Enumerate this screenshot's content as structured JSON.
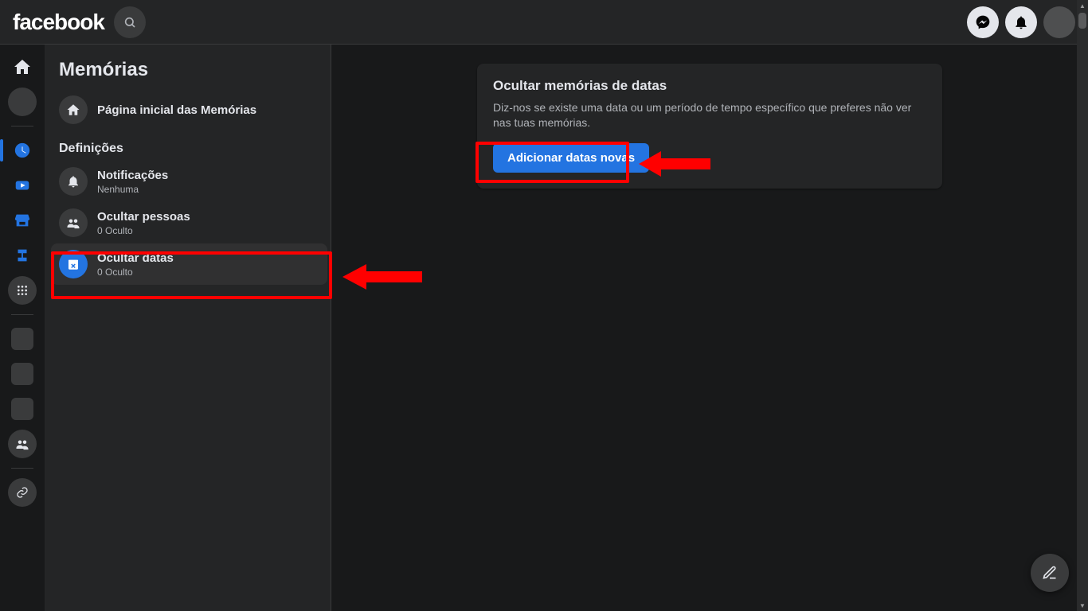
{
  "topbar": {
    "logo_text": "facebook"
  },
  "sidebar": {
    "title": "Memórias",
    "home_row": {
      "label": "Página inicial das Memórias"
    },
    "settings_label": "Definições",
    "items": [
      {
        "title": "Notificações",
        "subtitle": "Nenhuma"
      },
      {
        "title": "Ocultar pessoas",
        "subtitle": "0 Oculto"
      },
      {
        "title": "Ocultar datas",
        "subtitle": "0 Oculto"
      }
    ]
  },
  "card": {
    "title": "Ocultar memórias de datas",
    "body": "Diz-nos se existe uma data ou um período de tempo específico que preferes não ver nas tuas memórias.",
    "button": "Adicionar datas novas"
  }
}
